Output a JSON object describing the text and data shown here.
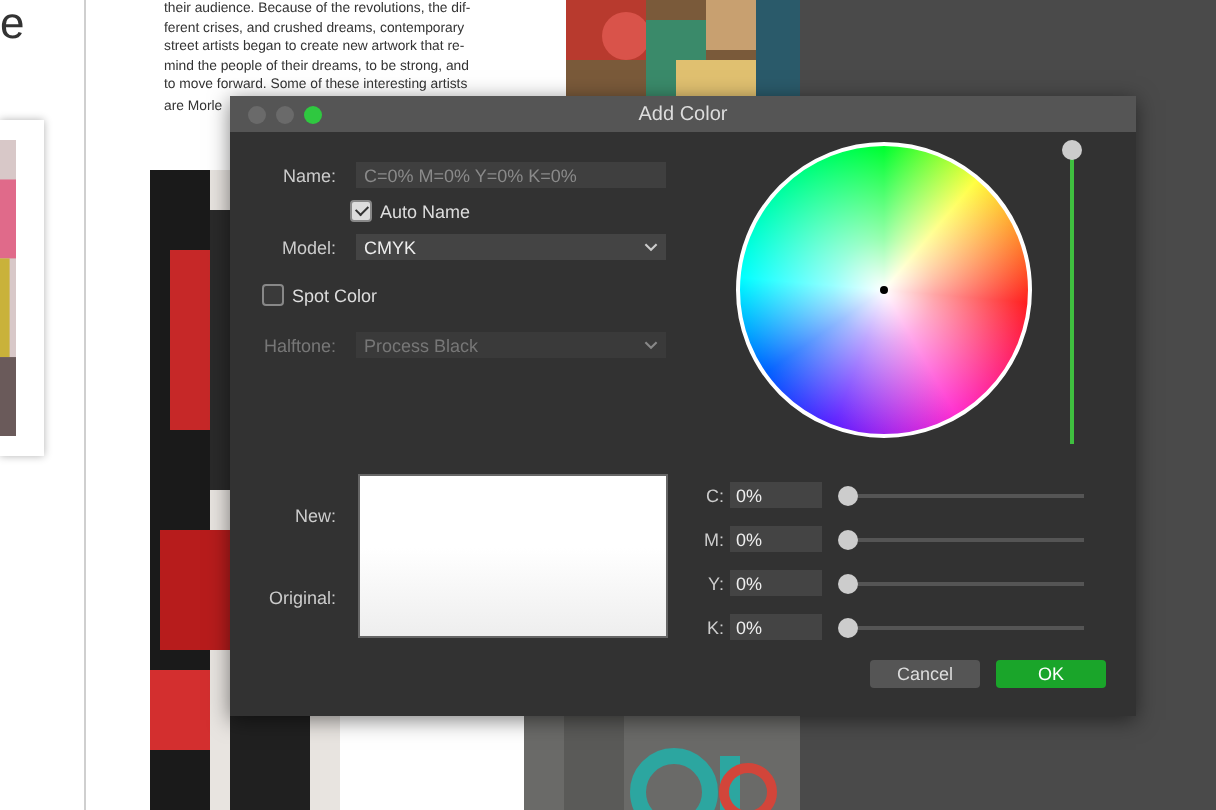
{
  "page": {
    "heading_fragment": "e",
    "paragraph_lines": [
      "their audience. Because of the revolutions, the dif-",
      "ferent crises, and crushed dreams, contemporary",
      "street artists began to create new artwork that re-",
      "mind the people of their dreams, to be strong, and",
      "to move forward. Some of these interesting artists"
    ],
    "cut_line": "are Morle"
  },
  "dialog": {
    "title": "Add Color",
    "name": {
      "label": "Name:",
      "value": "C=0% M=0% Y=0% K=0%",
      "disabled": true
    },
    "auto_name": {
      "label": "Auto Name",
      "checked": true
    },
    "model": {
      "label": "Model:",
      "value": "CMYK"
    },
    "spot_color": {
      "label": "Spot Color",
      "checked": false
    },
    "halftone": {
      "label": "Halftone:",
      "value": "Process Black",
      "disabled": true
    },
    "brightness": {
      "level": 1
    },
    "preview": {
      "new_label": "New:",
      "original_label": "Original:"
    },
    "channels": [
      {
        "label": "C:",
        "value": "0%",
        "level": 0
      },
      {
        "label": "M:",
        "value": "0%",
        "level": 0
      },
      {
        "label": "Y:",
        "value": "0%",
        "level": 0
      },
      {
        "label": "K:",
        "value": "0%",
        "level": 0
      }
    ],
    "buttons": [
      {
        "label": "Cancel",
        "kind": "secondary"
      },
      {
        "label": "OK",
        "kind": "primary"
      }
    ]
  }
}
